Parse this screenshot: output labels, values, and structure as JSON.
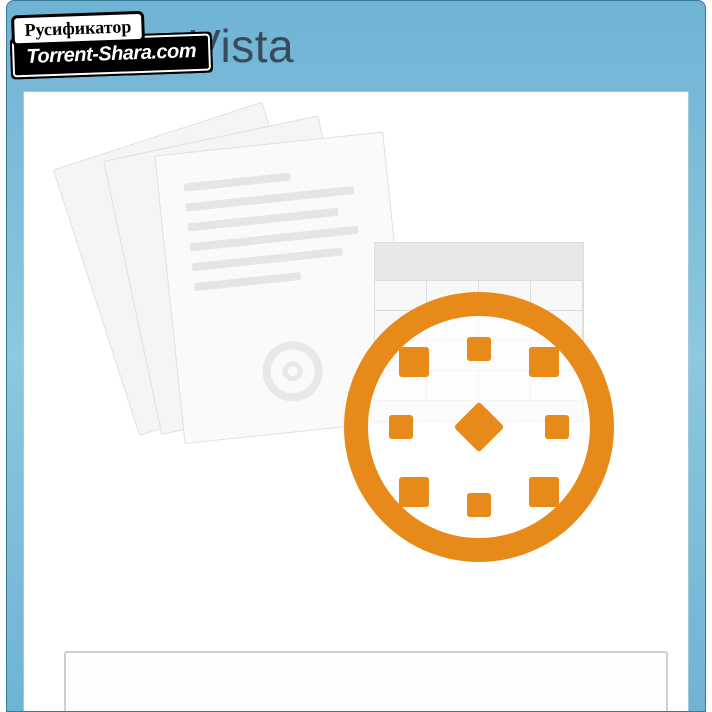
{
  "window": {
    "title": "Drive Vista"
  },
  "watermark": {
    "line1": "Русификатор",
    "line2": "Torrent-Shara.com"
  },
  "logo": {
    "accent_color": "#e88a1a"
  }
}
